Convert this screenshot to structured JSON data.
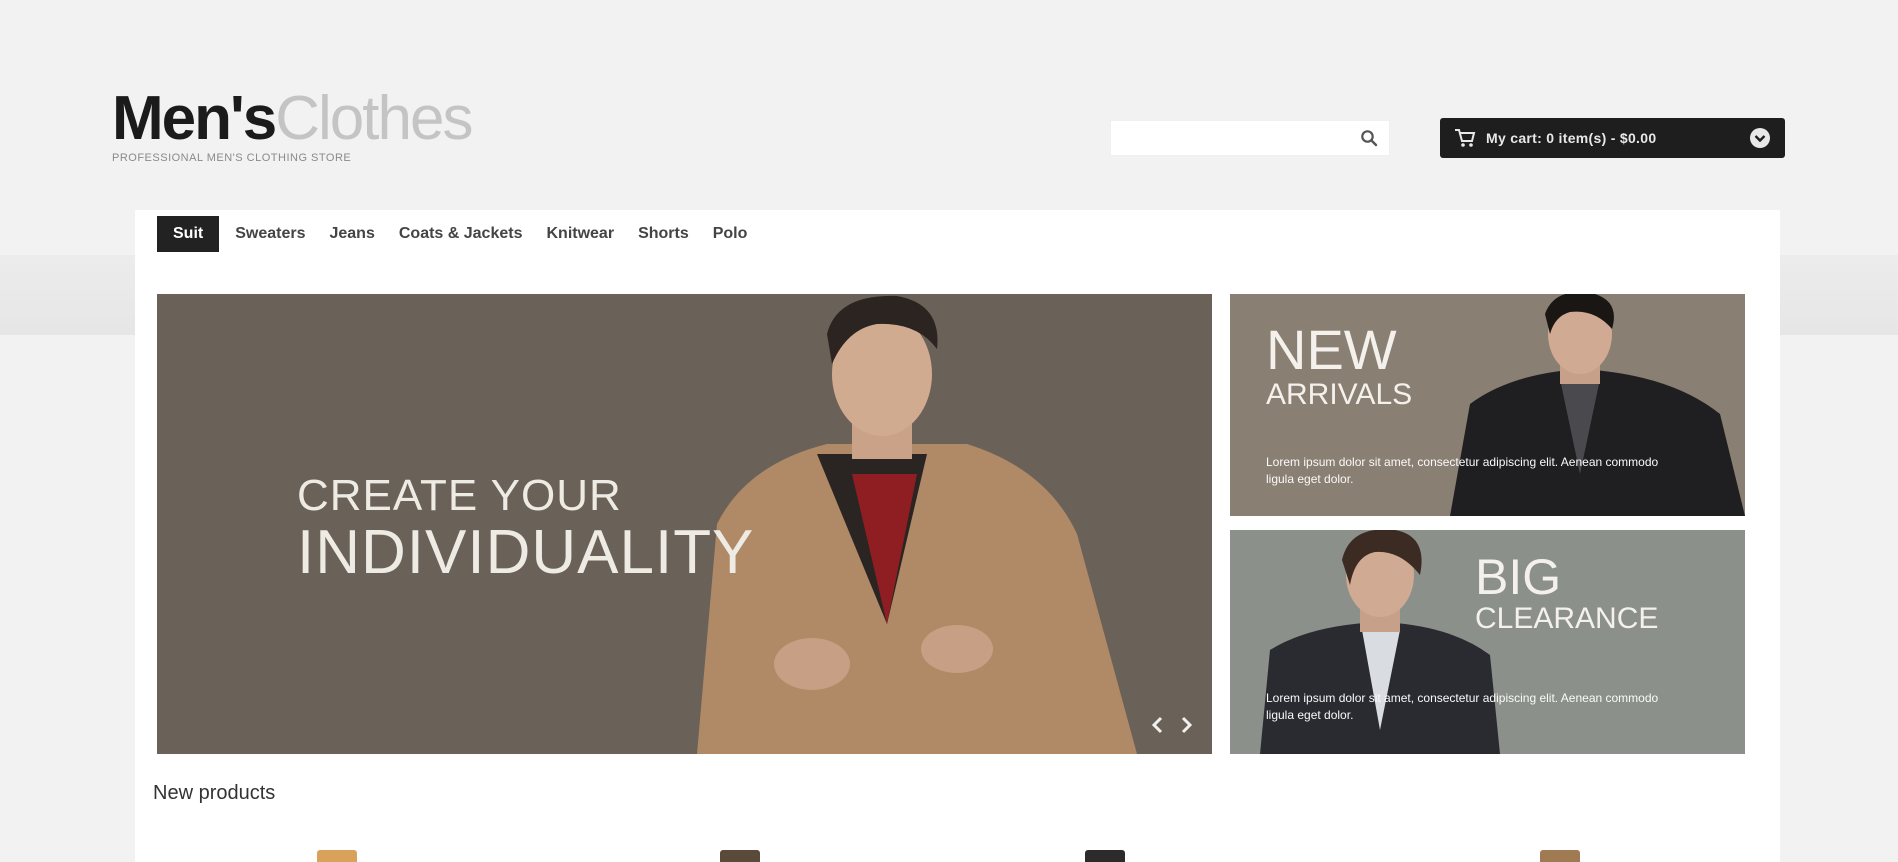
{
  "logo": {
    "bold": "Men's",
    "light": "Clothes",
    "tagline": "PROFESSIONAL MEN'S CLOTHING STORE"
  },
  "search": {
    "placeholder": "",
    "value": "",
    "icon": "search-icon"
  },
  "cart": {
    "label": "My cart: 0 item(s) - $0.00",
    "icon": "cart-icon",
    "arrow_icon": "chevron-down-icon"
  },
  "nav": {
    "items": [
      {
        "label": "Suit",
        "active": true
      },
      {
        "label": "Sweaters",
        "active": false
      },
      {
        "label": "Jeans",
        "active": false
      },
      {
        "label": "Coats & Jackets",
        "active": false
      },
      {
        "label": "Knitwear",
        "active": false
      },
      {
        "label": "Shorts",
        "active": false
      },
      {
        "label": "Polo",
        "active": false
      }
    ]
  },
  "slider": {
    "line1": "CREATE YOUR",
    "line2": "INDIVIDUALITY",
    "prev_icon": "chevron-left-icon",
    "next_icon": "chevron-right-icon"
  },
  "banners": [
    {
      "title_line1": "NEW",
      "title_line2": "ARRIVALS",
      "description": "Lorem ipsum dolor sit amet, consectetur adipiscing elit. Aenean commodo ligula eget dolor."
    },
    {
      "title_line1": "BIG",
      "title_line2": "CLEARANCE",
      "description": "Lorem ipsum dolor sit amet, consectetur adipiscing elit. Aenean commodo ligula eget dolor."
    }
  ],
  "section": {
    "title": "New products"
  },
  "colors": {
    "page_bg": "#f2f2f2",
    "dark": "#1e1e1e",
    "slider_bg": "#6a6158",
    "new_banner_bg": "#8a7f73",
    "big_banner_bg": "#8c908b"
  }
}
